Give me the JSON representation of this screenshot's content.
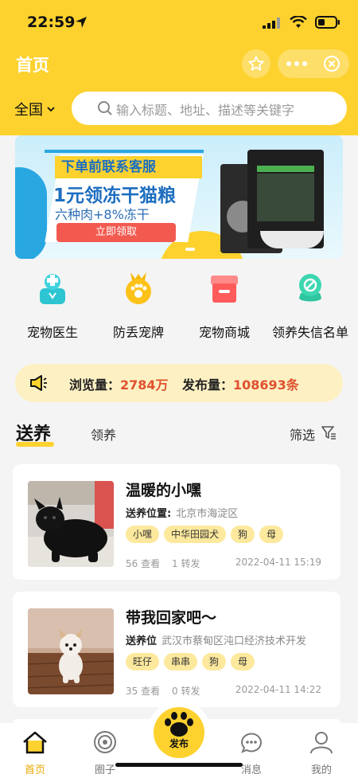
{
  "status_bar": {
    "time": "22:59"
  },
  "nav": {
    "title": "首页"
  },
  "search": {
    "region": "全国",
    "placeholder": "输入标题、地址、描述等关键字"
  },
  "banner": {
    "line1": "下单前联系客服",
    "line2": "1元领冻干猫粮",
    "line3": "六种肉+8%冻干",
    "button": "立即领取"
  },
  "quick_links": [
    {
      "label": "宠物医生",
      "icon": "doctor-icon"
    },
    {
      "label": "防丢宠牌",
      "icon": "pet-tag-icon"
    },
    {
      "label": "宠物商城",
      "icon": "shop-icon"
    },
    {
      "label": "领养失信名单",
      "icon": "blacklist-icon"
    }
  ],
  "stats": {
    "views_label": "浏览量：",
    "views_value": "2784万",
    "posts_label": "发布量：",
    "posts_value": "108693条"
  },
  "tabs": {
    "active": "送养",
    "other": "领养",
    "filter": "筛选"
  },
  "listings": [
    {
      "title": "温暖的小嘿",
      "addr_label": "送养位置:",
      "addr": "北京市海淀区",
      "tags": [
        "小嘿",
        "中华田园犬",
        "狗",
        "母"
      ],
      "views": "56 查看",
      "shares": "1 转发",
      "date": "2022-04-11 15:19"
    },
    {
      "title": "带我回家吧～",
      "addr_label": "送养位",
      "addr": "武汉市蔡甸区沌口经济技术开发",
      "tags": [
        "旺仔",
        "串串",
        "狗",
        "母"
      ],
      "views": "35 查看",
      "shares": "0 转发",
      "date": "2022-04-11 14:22"
    }
  ],
  "tabbar": [
    {
      "label": "首页",
      "icon": "home-icon",
      "active": true
    },
    {
      "label": "圈子",
      "icon": "circle-icon"
    },
    {
      "label": "发布",
      "icon": "paw-icon"
    },
    {
      "label": "消息",
      "icon": "message-icon"
    },
    {
      "label": "我的",
      "icon": "user-icon"
    }
  ],
  "colors": {
    "brand": "#fdd22f",
    "accent_text": "#e0512f",
    "tag_bg": "#fde99d"
  }
}
